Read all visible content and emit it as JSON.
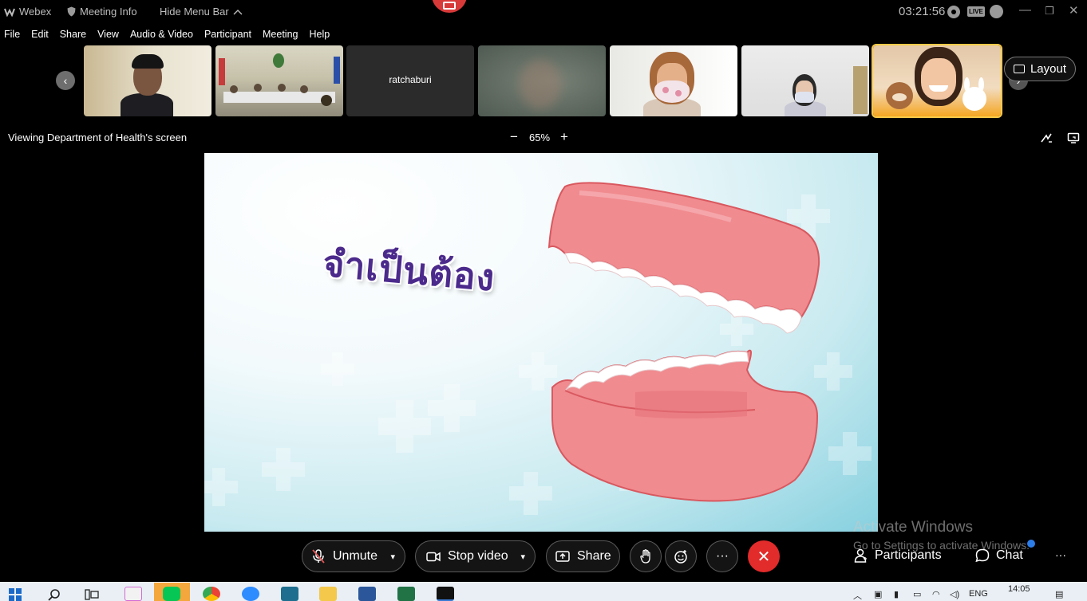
{
  "titlebar": {
    "app_name": "Webex",
    "meeting_info": "Meeting Info",
    "hide_menu": "Hide Menu Bar",
    "timer": "03:21:56",
    "live_badge": "LIVE"
  },
  "menu": [
    "File",
    "Edit",
    "Share",
    "View",
    "Audio & Video",
    "Participant",
    "Meeting",
    "Help"
  ],
  "filmstrip": {
    "tiles": [
      {
        "kind": "video",
        "label": ""
      },
      {
        "kind": "video",
        "label": ""
      },
      {
        "kind": "name",
        "label": "ratchaburi"
      },
      {
        "kind": "blurred",
        "label": ""
      },
      {
        "kind": "video",
        "label": ""
      },
      {
        "kind": "video",
        "label": ""
      },
      {
        "kind": "video",
        "label": "",
        "active": true
      }
    ],
    "layout_label": "Layout"
  },
  "viewbar": {
    "label": "Viewing Department of Health's screen",
    "zoom": "65%",
    "zoom_minus": "−",
    "zoom_plus": "+"
  },
  "slide": {
    "title": "จำเป็นต้อง"
  },
  "watermark": {
    "title": "Activate Windows",
    "subtitle": "Go to Settings to activate Windows."
  },
  "controls": {
    "unmute": "Unmute",
    "stop_video": "Stop video",
    "share": "Share",
    "more": "···",
    "participants": "Participants",
    "chat": "Chat",
    "more_right": "···"
  },
  "taskbar": {
    "language": "ENG",
    "time": "14:05"
  },
  "colors": {
    "end_call": "#e22b2b",
    "active_speaker": "#f7c948",
    "slide_text": "#4b2a8c",
    "gum_pink": "#f08b8f"
  }
}
